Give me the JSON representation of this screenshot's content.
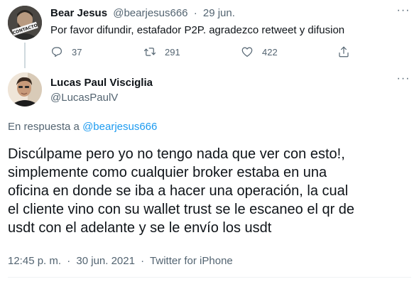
{
  "parent_tweet": {
    "display_name": "Bear Jesus",
    "handle": "@bearjesus666",
    "separator": "·",
    "date": "29 jun.",
    "text": "Por favor difundir, estafador P2P. agradezco retweet y difusion",
    "avatar_text": "CONTACTO",
    "more_icon": "more-horizontal-icon",
    "actions": {
      "reply_count": "37",
      "retweet_count": "291",
      "like_count": "422"
    }
  },
  "main_tweet": {
    "display_name": "Lucas Paul Visciglia",
    "handle": "@LucasPaulV",
    "more_icon": "more-horizontal-icon",
    "reply_to_prefix": "En respuesta a",
    "reply_to_handle": "@bearjesus666",
    "body_lines": [
      "Discúlpame pero yo no tengo nada que ver con esto!,",
      "simplemente como cualquier broker estaba en una",
      "oficina en donde se iba a hacer una operación, la cual",
      "el cliente vino con su wallet trust se le escaneo el qr de",
      "usdt con el adelante y se le envío los usdt"
    ],
    "time": "12:45 p. m.",
    "separator": "·",
    "date": "30 jun. 2021",
    "source": "Twitter for iPhone"
  },
  "colors": {
    "text": "#0f1419",
    "secondary": "#536471",
    "link": "#1d9bf0",
    "divider": "#eff3f4"
  }
}
